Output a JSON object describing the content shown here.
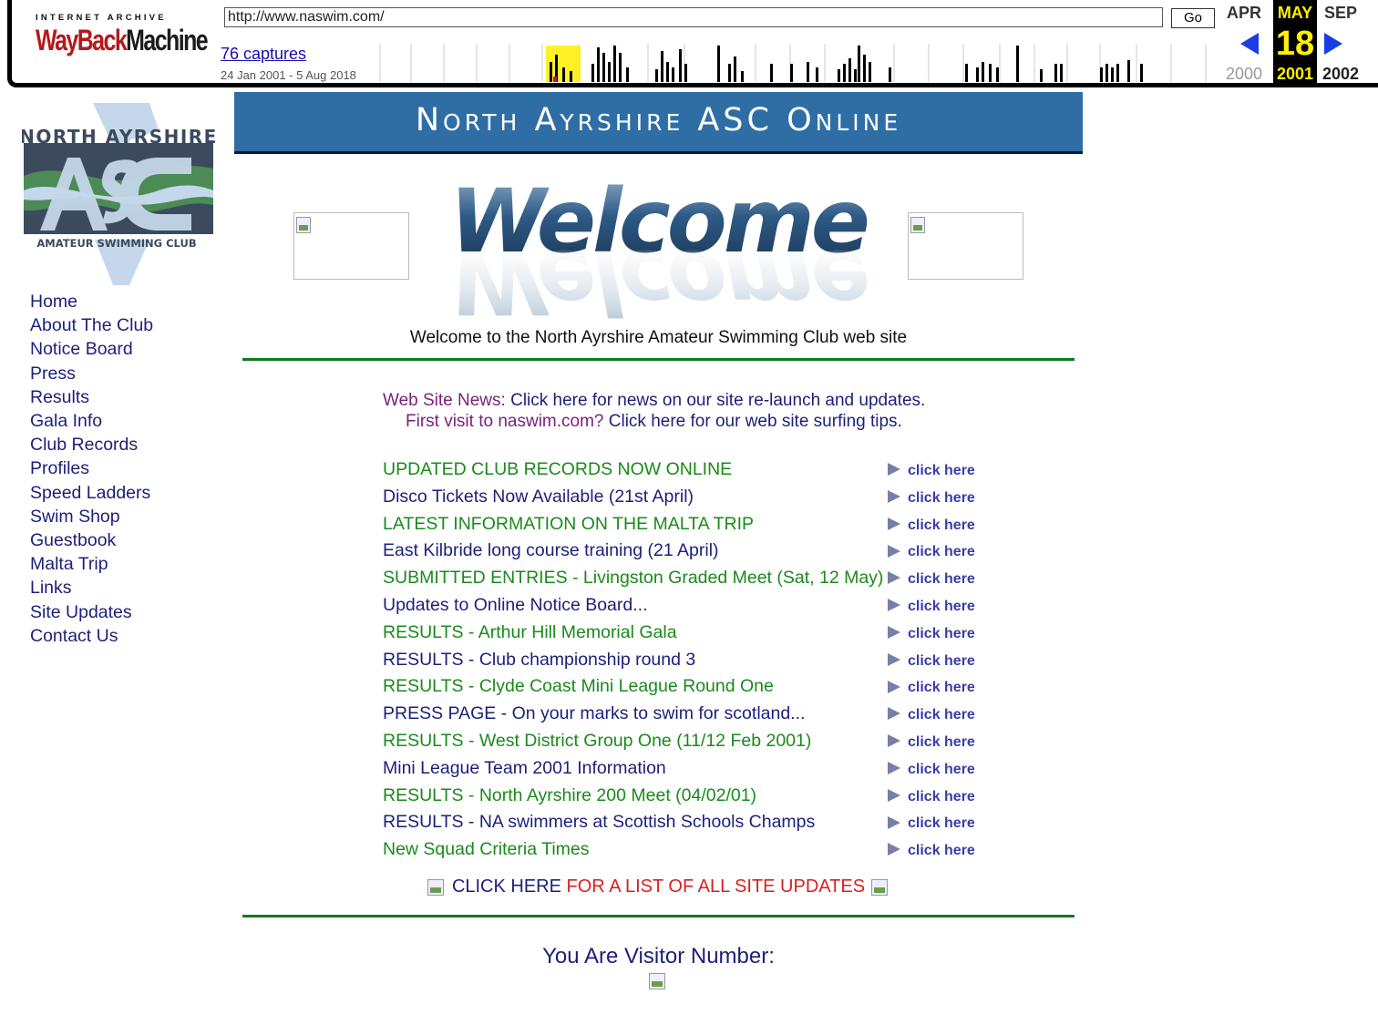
{
  "wayback": {
    "logo_top": "INTERNET ARCHIVE",
    "logo_wordmark_1": "WayBack",
    "logo_wordmark_2": "Machine",
    "url": "http://www.naswim.com/",
    "go_label": "Go",
    "captures_label": "76 captures",
    "date_range": "24 Jan 2001 - 5 Aug 2018",
    "prev_month": "APR",
    "current_month": "MAY",
    "next_month": "SEP",
    "current_day": "18",
    "prev_year": "2000",
    "current_year": "2001",
    "next_year": "2002",
    "accent_color": "#ffef00",
    "arrow_color": "#1a3ee0"
  },
  "club_logo": {
    "top_text": "NORTH AYRSHIRE",
    "bottom_text": "AMATEUR SWIMMING CLUB",
    "letters": "ASC"
  },
  "sidebar": {
    "items": [
      {
        "label": "Home"
      },
      {
        "label": "About The Club"
      },
      {
        "label": "Notice Board"
      },
      {
        "label": "Press"
      },
      {
        "label": "Results"
      },
      {
        "label": "Gala Info"
      },
      {
        "label": "Club Records"
      },
      {
        "label": "Profiles"
      },
      {
        "label": "Speed Ladders"
      },
      {
        "label": "Swim Shop"
      },
      {
        "label": "Guestbook"
      },
      {
        "label": "Malta Trip"
      },
      {
        "label": "Links"
      },
      {
        "label": "Site Updates"
      },
      {
        "label": "Contact Us"
      }
    ]
  },
  "banner": {
    "title": "North Ayrshire ASC Online",
    "color": "#2e6ea5"
  },
  "welcome": {
    "graphic_text": "Welcome",
    "line": "Welcome to the North Ayrshire Amateur Swimming Club web site"
  },
  "news": {
    "line1_prefix": "Web Site News: ",
    "line1_link": "Click here for news on our site re-launch and updates.",
    "line2_prefix": "First visit to naswim.com? ",
    "line2_link": "Click here for our web site surfing tips."
  },
  "click_here_label": "click here",
  "updates": [
    {
      "text": "UPDATED CLUB RECORDS NOW ONLINE",
      "color": "green"
    },
    {
      "text": "Disco Tickets Now Available (21st April)",
      "color": "navy"
    },
    {
      "text": "LATEST INFORMATION ON THE MALTA TRIP",
      "color": "green"
    },
    {
      "text": "East Kilbride long course training (21 April)",
      "color": "navy"
    },
    {
      "text": "SUBMITTED ENTRIES - Livingston Graded Meet (Sat, 12 May)",
      "color": "green"
    },
    {
      "text": "Updates to Online Notice Board...",
      "color": "navy"
    },
    {
      "text": "RESULTS - Arthur Hill Memorial Gala",
      "color": "green"
    },
    {
      "text": "RESULTS - Club championship round 3",
      "color": "navy"
    },
    {
      "text": "RESULTS - Clyde Coast Mini League Round One",
      "color": "green"
    },
    {
      "text": "PRESS PAGE - On your marks to swim for scotland...",
      "color": "navy"
    },
    {
      "text": "RESULTS - West District Group One (11/12 Feb 2001)",
      "color": "green"
    },
    {
      "text": "Mini League Team 2001 Information",
      "color": "navy"
    },
    {
      "text": "RESULTS - North Ayrshire 200 Meet (04/02/01)",
      "color": "green"
    },
    {
      "text": "RESULTS - NA swimmers at Scottish Schools Champs",
      "color": "navy"
    },
    {
      "text": "New Squad Criteria Times",
      "color": "green"
    }
  ],
  "all_updates": {
    "part1": "CLICK HERE",
    "part2": " FOR A LIST OF ALL SITE UPDATES"
  },
  "visitor": {
    "label": "You Are Visitor Number:"
  }
}
